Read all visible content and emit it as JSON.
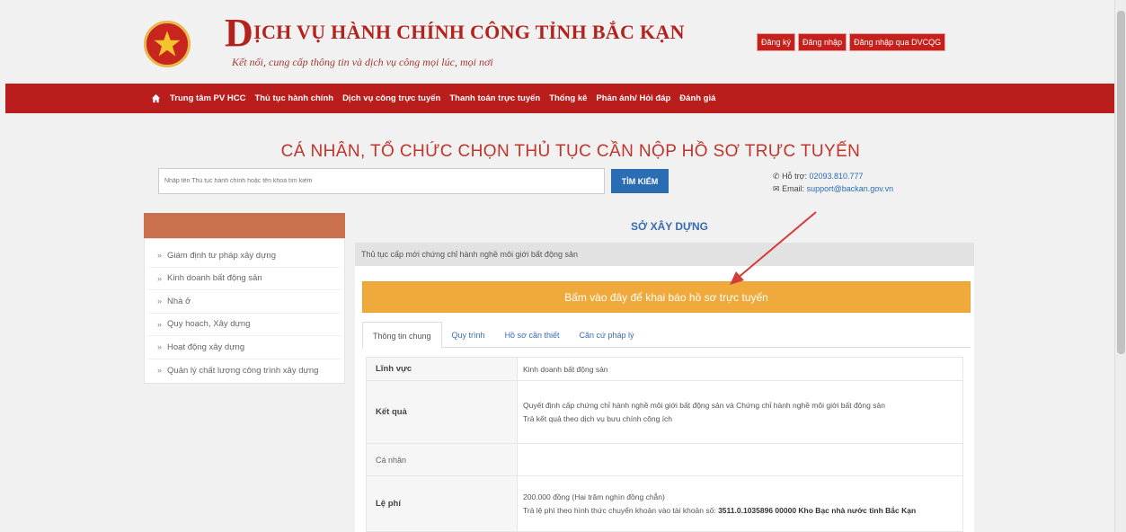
{
  "header": {
    "title_initial": "D",
    "title_rest": "ỊCH VỤ HÀNH CHÍNH CÔNG TỈNH BẮC KẠN",
    "slogan": "Kết nối, cung cấp thông tin và dịch vụ công mọi lúc, mọi nơi",
    "auth_buttons": [
      "Đăng ký",
      "Đăng nhập",
      "Đăng nhập qua DVCQG"
    ]
  },
  "nav": {
    "icon": "home-icon",
    "items": [
      "Trung tâm PV HCC",
      "Thủ tục hành chính",
      "Dịch vụ công trực tuyến",
      "Thanh toán trực tuyến",
      "Thống kê",
      "Phản ánh/ Hỏi đáp",
      "Đánh giá"
    ]
  },
  "page": {
    "heading": "CÁ NHÂN, TỔ CHỨC CHỌN THỦ TỤC CẦN NỘP HỒ SƠ TRỰC TUYẾN",
    "search_placeholder": "Nhập tên Thủ tục hành chính hoặc tên khoá tìm kiếm",
    "search_button": "TÌM KIẾM",
    "hotline_label": "Hỗ trợ:",
    "hotline": "02093.810.777",
    "email_label": "Email:",
    "email": "support@backan.gov.vn"
  },
  "sidebar": {
    "items": [
      "Giám định tư pháp xây dựng",
      "Kinh doanh bất động sản",
      "Nhà ở",
      "Quy hoạch, Xây dựng",
      "Hoạt động xây dựng",
      "Quản lý chất lượng công trình xây dựng"
    ]
  },
  "main": {
    "department": "SỞ XÂY DỰNG",
    "procedure": "Thủ tục cấp mới chứng chỉ hành nghề môi giới bất động sản",
    "cta": "Bấm vào đây để khai báo hồ sơ trực tuyến",
    "tabs": [
      "Thông tin chung",
      "Quy trình",
      "Hồ sơ cần thiết",
      "Căn cứ pháp lý"
    ],
    "rows": {
      "linh_vuc": {
        "label": "Lĩnh vực",
        "value": "Kinh doanh bất động sản"
      },
      "ket_qua": {
        "label": "Kết quả",
        "line1": "Quyết định cấp chứng chỉ hành nghề môi giới bất động sản và Chứng chỉ hành nghề môi giới bất động sản",
        "line2": "Trả kết quả theo dịch vụ bưu chính công ích"
      },
      "ca_nhan": {
        "label": "Cá nhân",
        "value": ""
      },
      "le_phi": {
        "label": "Lệ phí",
        "line1": "200.000 đồng (Hai trăm nghìn đồng chẵn)",
        "line2_text": "Trả lệ phí theo hình thức chuyển khoản vào tài khoản số: ",
        "line2_bold": "3511.0.1035896 00000 Kho Bạc nhà nước tỉnh Bắc Kạn"
      }
    }
  }
}
